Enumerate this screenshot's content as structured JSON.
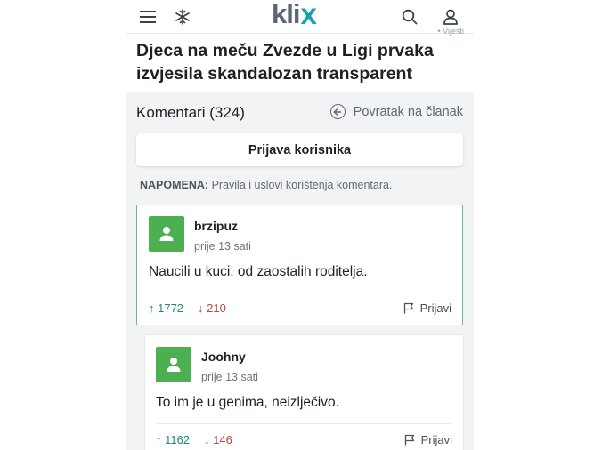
{
  "header": {
    "logo_main": "kli",
    "logo_x": "x",
    "tiny_tag": "• Vijesti",
    "icons": [
      "menu-icon",
      "snowflake-icon",
      "search-icon",
      "user-icon"
    ]
  },
  "article": {
    "title": "Djeca na meču Zvezde u Ligi prvaka izvjesila skandalozan transparent"
  },
  "comments_section": {
    "title": "Komentari (324)",
    "back_label": "Povratak na članak",
    "report_user_button": "Prijava korisnika",
    "note_label": "NAPOMENA:",
    "note_text": " Pravila i uslovi korištenja komentara."
  },
  "comments": [
    {
      "username": "brzipuz",
      "time": "prije 13 sati",
      "text": "Naucili u kuci, od zaostalih roditelja.",
      "upvotes": "↑ 1772",
      "downvotes": "↓ 210",
      "report_label": "Prijavi"
    },
    {
      "username": "Joohny",
      "time": "prije 13 sati",
      "text": "To im je u genima, neizlječivo.",
      "upvotes": "↑ 1162",
      "downvotes": "↓ 146",
      "report_label": "Prijavi"
    }
  ],
  "colors": {
    "brand_teal": "#14a3ab",
    "avatar_green": "#4caf50",
    "upvote": "#1f8a78",
    "downvote": "#c0443f",
    "panel_bg": "#f1f3f5"
  }
}
